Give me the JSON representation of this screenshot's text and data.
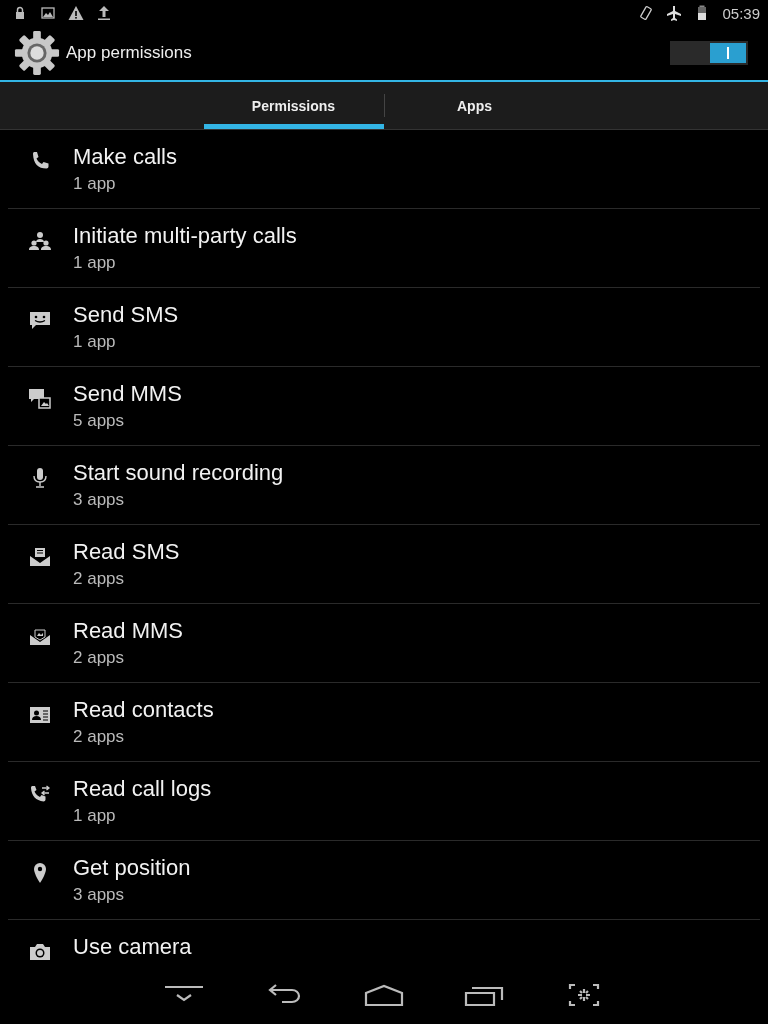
{
  "status_bar": {
    "time": "05:39"
  },
  "action_bar": {
    "title": "App permissions",
    "switch_on": true
  },
  "tabs": [
    {
      "label": "Permissions",
      "selected": true
    },
    {
      "label": "Apps",
      "selected": false
    }
  ],
  "permissions": [
    {
      "title": "Make calls",
      "count": "1 app"
    },
    {
      "title": "Initiate multi-party calls",
      "count": "1 app"
    },
    {
      "title": "Send SMS",
      "count": "1 app"
    },
    {
      "title": "Send MMS",
      "count": "5 apps"
    },
    {
      "title": "Start sound recording",
      "count": "3 apps"
    },
    {
      "title": "Read SMS",
      "count": "2 apps"
    },
    {
      "title": "Read MMS",
      "count": "2 apps"
    },
    {
      "title": "Read contacts",
      "count": "2 apps"
    },
    {
      "title": "Read call logs",
      "count": "1 app"
    },
    {
      "title": "Get position",
      "count": "3 apps"
    },
    {
      "title": "Use camera"
    }
  ]
}
